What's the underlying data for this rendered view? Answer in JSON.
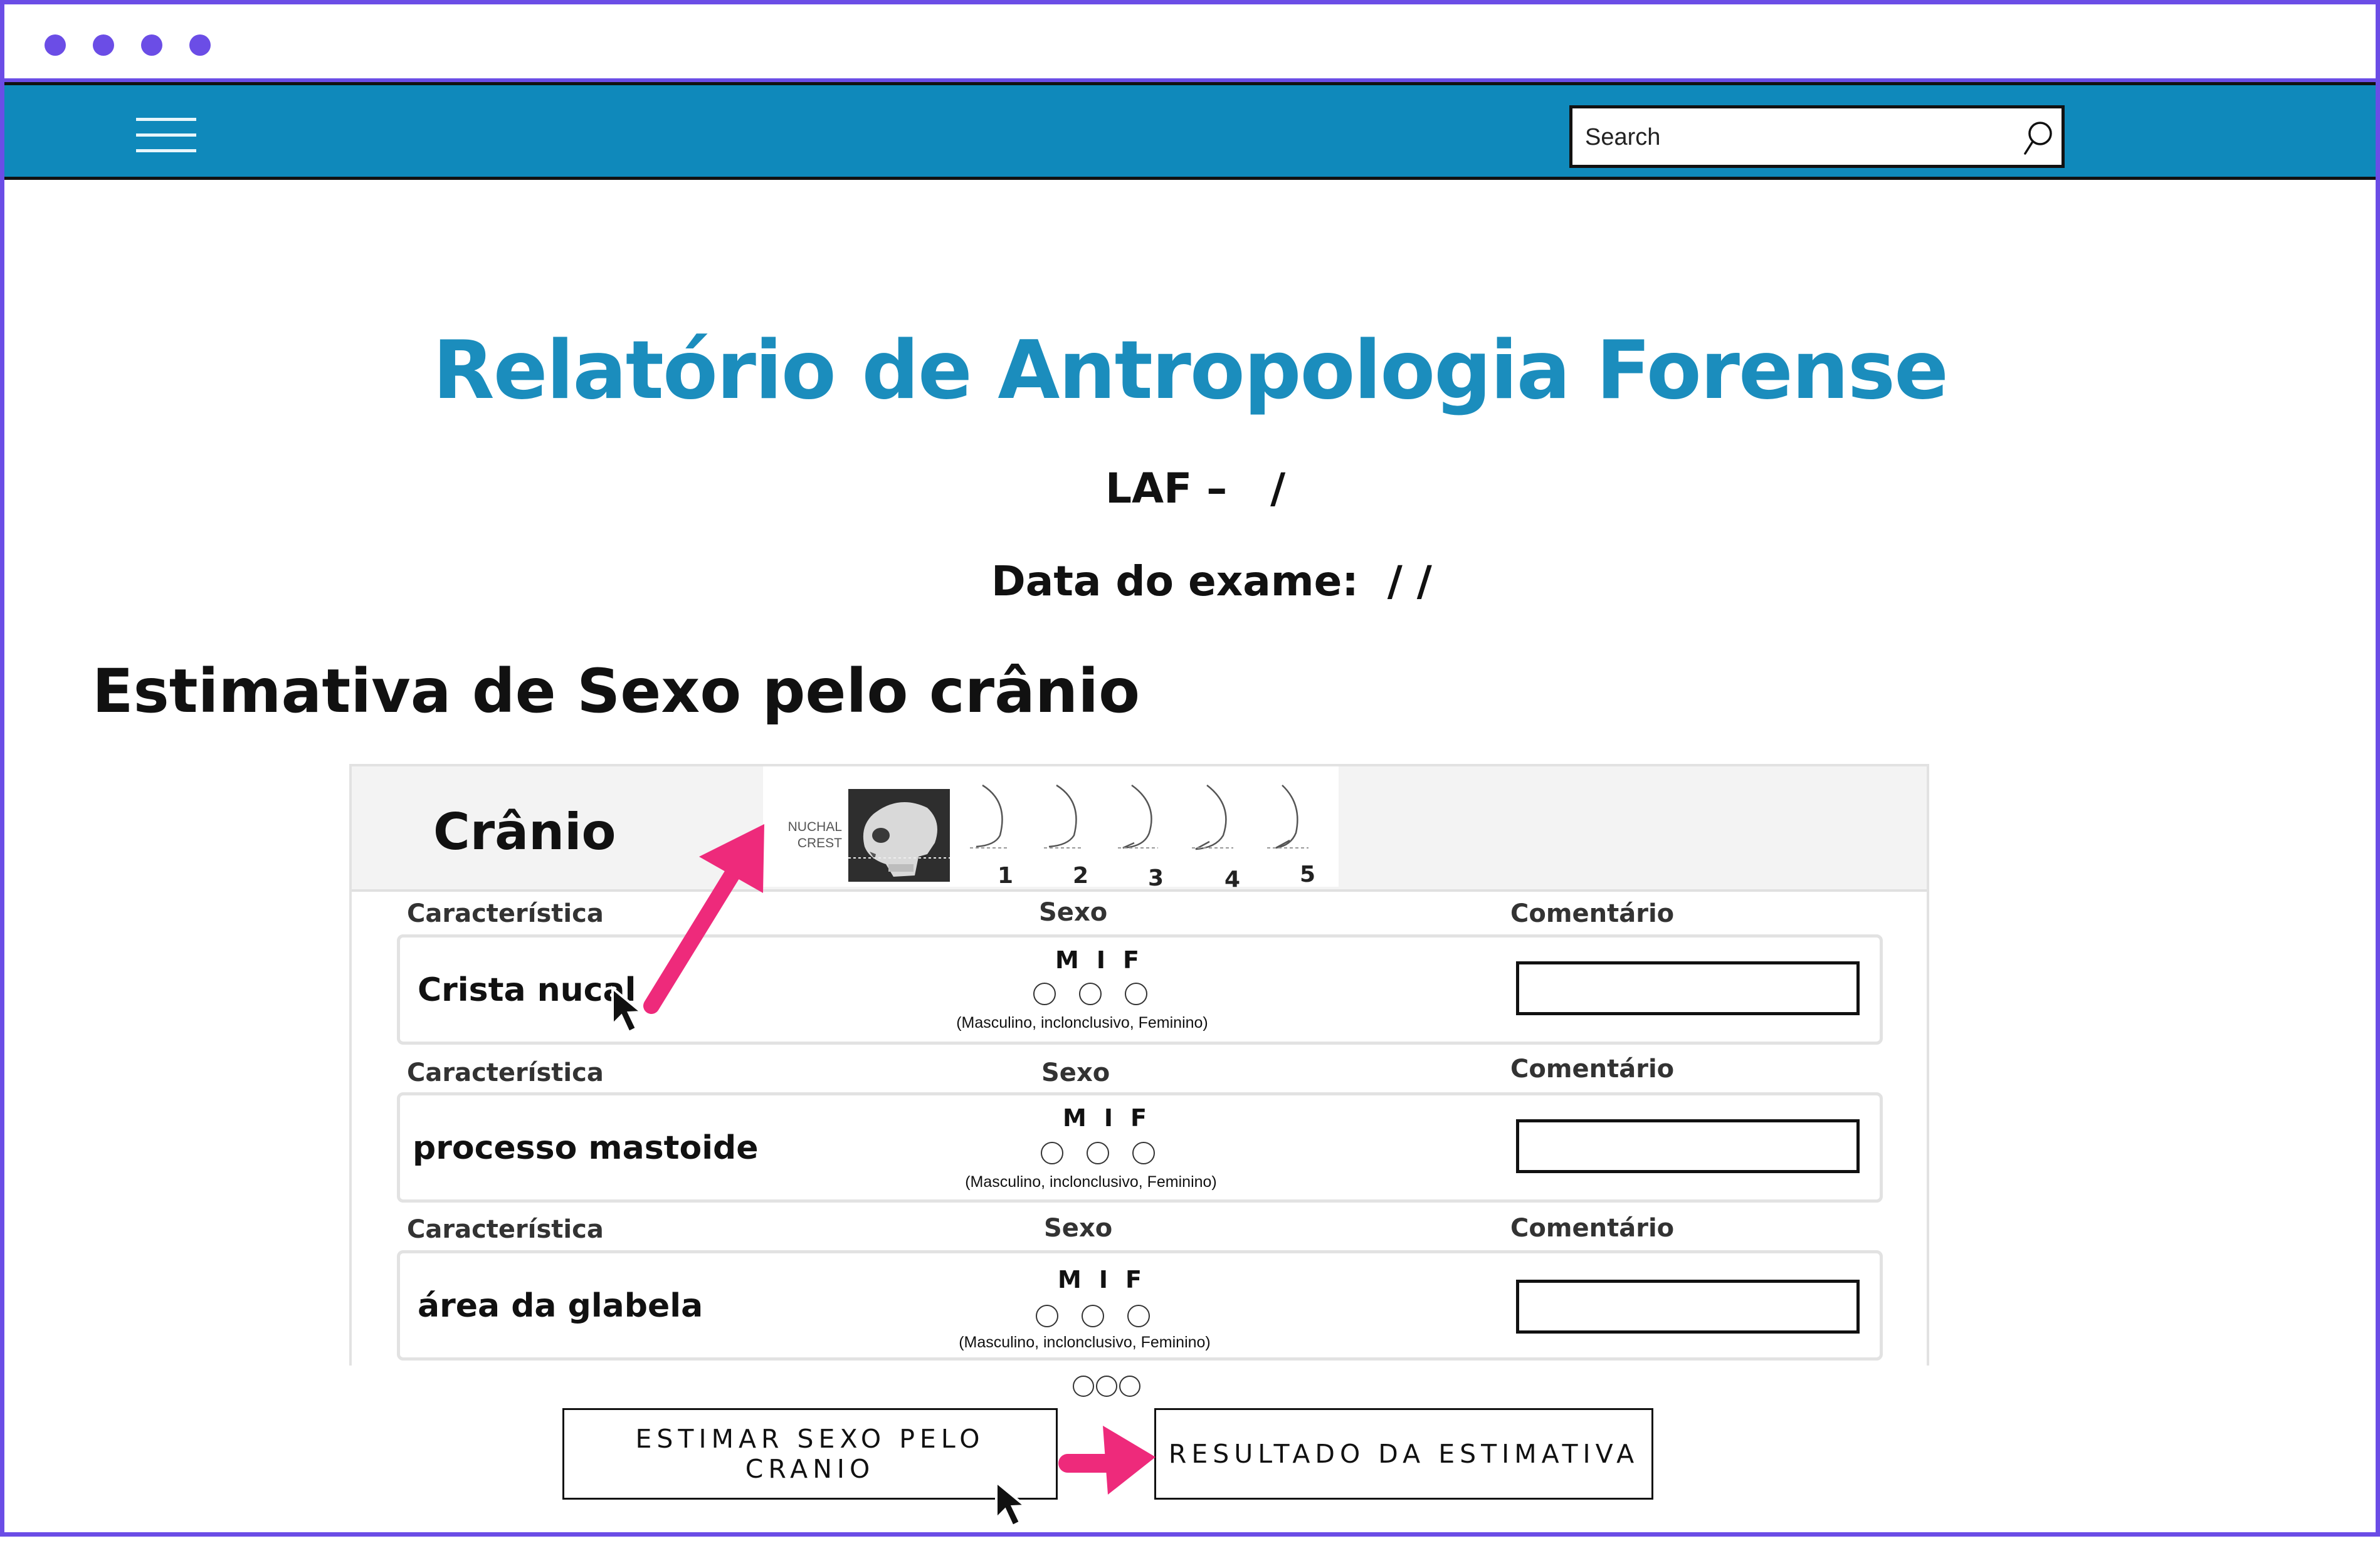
{
  "window": {
    "dots": 4,
    "accent": "#6b4de6"
  },
  "navbar": {
    "color": "#0f89bb",
    "menu_icon": "hamburger-icon",
    "search": {
      "placeholder": "Search",
      "icon": "search-icon"
    }
  },
  "report": {
    "title": "Relatório de Antropologia Forense",
    "laf": "LAF –   /",
    "exam_date": "Data do exame:  / /"
  },
  "section": {
    "title": "Estimativa de Sexo pelo crânio"
  },
  "card": {
    "title": "Crânio",
    "figure": {
      "caption": "NUCHAL CREST",
      "scale": [
        "1",
        "2",
        "3",
        "4",
        "5"
      ]
    },
    "columns": {
      "feature": "Característica",
      "sex": "Sexo",
      "comment": "Comentário"
    },
    "rows": [
      {
        "feature": "Crista nucal",
        "options": [
          "M",
          "I",
          "F"
        ],
        "legend": "(Masculino, inclonclusivo, Feminino)",
        "comment": ""
      },
      {
        "feature": "processo mastoide",
        "options": [
          "M",
          "I",
          "F"
        ],
        "legend": "(Masculino, inclonclusivo, Feminino)",
        "comment": ""
      },
      {
        "feature": "área da glabela",
        "options": [
          "M",
          "I",
          "F"
        ],
        "legend": "(Masculino, inclonclusivo, Feminino)",
        "comment": ""
      }
    ]
  },
  "pagination": {
    "pages": 3
  },
  "actions": {
    "estimate_label": "ESTIMAR SEXO PELO CRANIO",
    "result_label": "RESULTADO DA ESTIMATIVA"
  },
  "annotations": {
    "arrow_color": "#ee2a7b",
    "cursor_icon": "mouse-cursor-icon"
  }
}
